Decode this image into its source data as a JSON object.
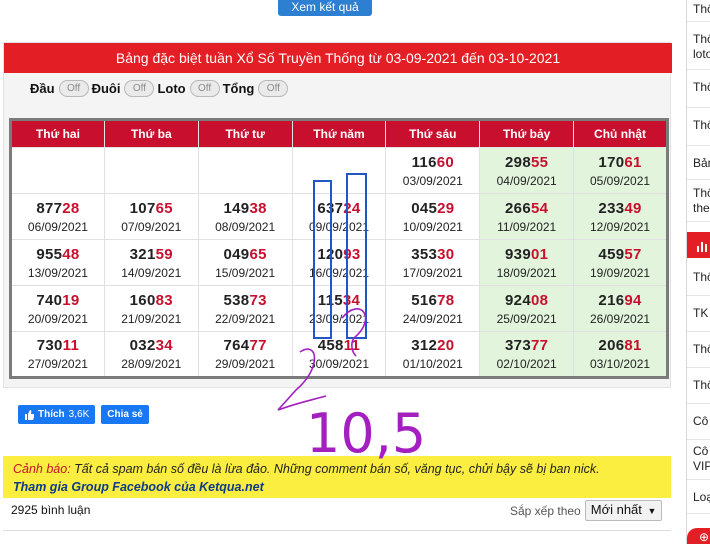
{
  "top_button": {
    "label": "Xem kết quả"
  },
  "panel": {
    "title": "Bảng đặc biệt tuần Xổ Số Truyền Thống từ 03-09-2021 đến 03-10-2021",
    "toggles": [
      {
        "label": "Đầu",
        "state": "Off"
      },
      {
        "label": "Đuôi",
        "state": "Off"
      },
      {
        "label": "Loto",
        "state": "Off"
      },
      {
        "label": "Tổng",
        "state": "Off"
      }
    ]
  },
  "table": {
    "headers": [
      "Thứ hai",
      "Thứ ba",
      "Thứ tư",
      "Thứ năm",
      "Thứ sáu",
      "Thứ bảy",
      "Chủ nhật"
    ],
    "rows": [
      [
        {
          "head": "",
          "tail": "",
          "date": ""
        },
        {
          "head": "",
          "tail": "",
          "date": ""
        },
        {
          "head": "",
          "tail": "",
          "date": ""
        },
        {
          "head": "",
          "tail": "",
          "date": ""
        },
        {
          "head": "116",
          "tail": "60",
          "date": "03/09/2021"
        },
        {
          "head": "298",
          "tail": "55",
          "date": "04/09/2021"
        },
        {
          "head": "170",
          "tail": "61",
          "date": "05/09/2021"
        }
      ],
      [
        {
          "head": "877",
          "tail": "28",
          "date": "06/09/2021"
        },
        {
          "head": "107",
          "tail": "65",
          "date": "07/09/2021"
        },
        {
          "head": "149",
          "tail": "38",
          "date": "08/09/2021"
        },
        {
          "head": "637",
          "tail": "24",
          "date": "09/09/2021"
        },
        {
          "head": "045",
          "tail": "29",
          "date": "10/09/2021"
        },
        {
          "head": "266",
          "tail": "54",
          "date": "11/09/2021"
        },
        {
          "head": "233",
          "tail": "49",
          "date": "12/09/2021"
        }
      ],
      [
        {
          "head": "955",
          "tail": "48",
          "date": "13/09/2021"
        },
        {
          "head": "321",
          "tail": "59",
          "date": "14/09/2021"
        },
        {
          "head": "049",
          "tail": "65",
          "date": "15/09/2021"
        },
        {
          "head": "120",
          "tail": "93",
          "date": "16/09/2021"
        },
        {
          "head": "353",
          "tail": "30",
          "date": "17/09/2021"
        },
        {
          "head": "939",
          "tail": "01",
          "date": "18/09/2021"
        },
        {
          "head": "459",
          "tail": "57",
          "date": "19/09/2021"
        }
      ],
      [
        {
          "head": "740",
          "tail": "19",
          "date": "20/09/2021"
        },
        {
          "head": "160",
          "tail": "83",
          "date": "21/09/2021"
        },
        {
          "head": "538",
          "tail": "73",
          "date": "22/09/2021"
        },
        {
          "head": "115",
          "tail": "34",
          "date": "23/09/2021"
        },
        {
          "head": "516",
          "tail": "78",
          "date": "24/09/2021"
        },
        {
          "head": "924",
          "tail": "08",
          "date": "25/09/2021"
        },
        {
          "head": "216",
          "tail": "94",
          "date": "26/09/2021"
        }
      ],
      [
        {
          "head": "730",
          "tail": "11",
          "date": "27/09/2021"
        },
        {
          "head": "032",
          "tail": "34",
          "date": "28/09/2021"
        },
        {
          "head": "764",
          "tail": "77",
          "date": "29/09/2021"
        },
        {
          "head": "458",
          "tail": "11",
          "date": "30/09/2021"
        },
        {
          "head": "312",
          "tail": "20",
          "date": "01/10/2021"
        },
        {
          "head": "373",
          "tail": "77",
          "date": "02/10/2021"
        },
        {
          "head": "206",
          "tail": "81",
          "date": "03/10/2021"
        }
      ]
    ]
  },
  "social": {
    "like_label": "Thích",
    "like_count": "3,6K",
    "share_label": "Chia sẻ"
  },
  "warning": {
    "label": "Cảnh báo:",
    "text": " Tất cả spam bán số đều là lừa đảo. Những comment bán số, văng tục, chửi bậy sẽ bị ban nick.",
    "link": "Tham gia Group Facebook của Ketqua.net"
  },
  "comments": {
    "count": "2925 bình luận",
    "sort_label": "Sắp xếp theo",
    "sort_value": "Mới nhất"
  },
  "handwriting": {
    "note": "10,5"
  },
  "sidebar": {
    "items": [
      "Thố",
      "Thố lotơ",
      "Thố",
      "Thố",
      "Bản",
      "Thố thea",
      "Thố",
      "TK",
      "Thố",
      "Thố",
      "Cô",
      "Cô VIP",
      "Loạ"
    ]
  },
  "colors": {
    "header_red": "#e31e24",
    "table_header": "#c8102e",
    "weekend_bg": "#e2f5dc",
    "warning_bg": "#fbee41",
    "fb_blue": "#1877f2",
    "ink_blue": "#2056c8",
    "ink_purple": "#a41fc0"
  }
}
